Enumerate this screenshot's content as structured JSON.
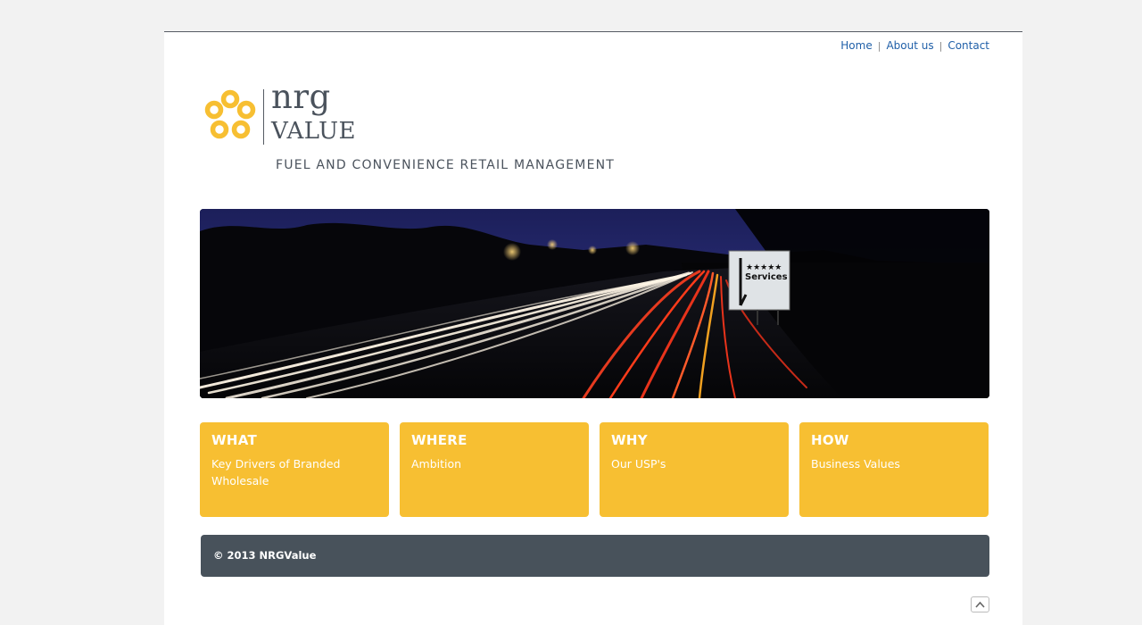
{
  "nav": {
    "items": [
      {
        "label": "Home"
      },
      {
        "label": "About us"
      },
      {
        "label": "Contact"
      }
    ],
    "separator": "|"
  },
  "brand": {
    "line1": "nrg",
    "line2": "value",
    "tagline": "FUEL AND CONVENIENCE RETAIL MANAGEMENT",
    "color": "#4a525c",
    "logo_color": "#f7bf32"
  },
  "hero": {
    "image": "night-motorway-light-trails",
    "sign_stars": "★★★★★",
    "sign_text": "Services"
  },
  "features": [
    {
      "title": "WHAT",
      "subtitle": "Key Drivers of Branded Wholesale"
    },
    {
      "title": "WHERE",
      "subtitle": "Ambition"
    },
    {
      "title": "WHY",
      "subtitle": "Our USP's"
    },
    {
      "title": "HOW",
      "subtitle": "Business Values"
    }
  ],
  "footer": {
    "copyright": "© 2013 NRGValue"
  },
  "colors": {
    "accent": "#f7bf32",
    "footer_bg": "#48525b",
    "link": "#1f5fa8"
  },
  "back_to_top": {
    "icon": "chevron-up-icon"
  }
}
